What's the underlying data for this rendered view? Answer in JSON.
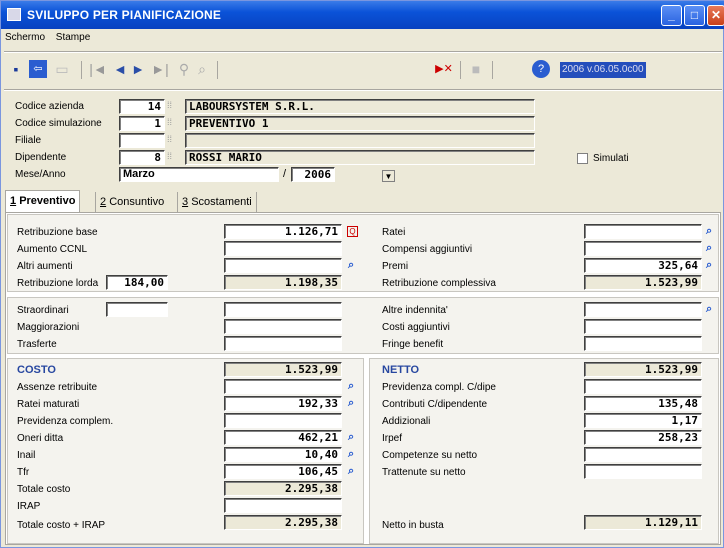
{
  "window": {
    "title": "SVILUPPO PER PIANIFICAZIONE"
  },
  "menu": [
    "Schermo",
    "Stampe"
  ],
  "toolbar": {
    "version": "2006 v.06.05.0c00"
  },
  "header": {
    "codice_azienda": {
      "label": "Codice azienda",
      "code": "14",
      "value": "LABOURSYSTEM S.R.L."
    },
    "codice_simulazione": {
      "label": "Codice simulazione",
      "code": "1",
      "value": "PREVENTIVO 1"
    },
    "filiale": {
      "label": "Filiale",
      "code": "",
      "value": ""
    },
    "dipendente": {
      "label": "Dipendente",
      "code": "8",
      "value": "ROSSI MARIO"
    },
    "mese_anno": {
      "label": "Mese/Anno",
      "month": "Marzo",
      "sep": "/",
      "year": "2006"
    },
    "simulati_label": "Simulati"
  },
  "tabs": [
    {
      "num": "1",
      "label": "Preventivo"
    },
    {
      "num": "2",
      "label": "Consuntivo"
    },
    {
      "num": "3",
      "label": "Scostamenti"
    }
  ],
  "top_left": [
    {
      "label": "Retribuzione base",
      "value": "1.126,71"
    },
    {
      "label": "Aumento CCNL",
      "value": ""
    },
    {
      "label": "Altri aumenti",
      "value": ""
    },
    {
      "label": "Retribuzione lorda",
      "extra": "184,00",
      "value": "1.198,35"
    }
  ],
  "top_right": [
    {
      "label": "Ratei",
      "value": ""
    },
    {
      "label": "Compensi aggiuntivi",
      "value": ""
    },
    {
      "label": "Premi",
      "value": "325,64"
    },
    {
      "label": "Retribuzione complessiva",
      "value": "1.523,99"
    }
  ],
  "mid_left": [
    {
      "label": "Straordinari",
      "value": ""
    },
    {
      "label": "Maggiorazioni",
      "value": ""
    },
    {
      "label": "Trasferte",
      "value": ""
    }
  ],
  "mid_right": [
    {
      "label": "Altre indennita'",
      "value": ""
    },
    {
      "label": "Costi aggiuntivi",
      "value": ""
    },
    {
      "label": "Fringe benefit",
      "value": ""
    }
  ],
  "costo": {
    "title": "COSTO",
    "total": "1.523,99",
    "rows": [
      {
        "label": "Assenze retribuite",
        "value": ""
      },
      {
        "label": "Ratei maturati",
        "value": "192,33"
      },
      {
        "label": "Previdenza complem.",
        "value": ""
      },
      {
        "label": "Oneri ditta",
        "value": "462,21"
      },
      {
        "label": "Inail",
        "value": "10,40"
      },
      {
        "label": "Tfr",
        "value": "106,45"
      },
      {
        "label": "Totale costo",
        "value": "2.295,38"
      },
      {
        "label": "IRAP",
        "value": ""
      },
      {
        "label": "Totale costo + IRAP",
        "value": "2.295,38"
      }
    ]
  },
  "netto": {
    "title": "NETTO",
    "total": "1.523,99",
    "rows": [
      {
        "label": "Previdenza compl. C/dipe",
        "value": ""
      },
      {
        "label": "Contributi C/dipendente",
        "value": "135,48"
      },
      {
        "label": "Addizionali",
        "value": "1,17"
      },
      {
        "label": "Irpef",
        "value": "258,23"
      },
      {
        "label": "Competenze su netto",
        "value": ""
      },
      {
        "label": "Trattenute su netto",
        "value": ""
      }
    ],
    "busta_label": "Netto in busta",
    "busta_value": "1.129,11"
  }
}
